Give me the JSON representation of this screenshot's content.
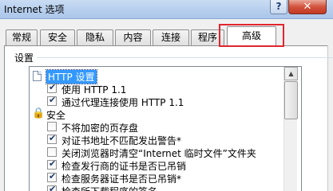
{
  "window": {
    "title": "Internet 选项",
    "help_label": "?",
    "close_label": "✕"
  },
  "tabs": [
    {
      "label": "常规"
    },
    {
      "label": "安全"
    },
    {
      "label": "隐私"
    },
    {
      "label": "内容"
    },
    {
      "label": "连接"
    },
    {
      "label": "程序"
    },
    {
      "label": "高级",
      "active": true
    }
  ],
  "settings": {
    "group_label": "设置",
    "items": [
      {
        "type": "category",
        "icon": "page-icon",
        "label": "HTTP 设置",
        "selected": true
      },
      {
        "type": "checkbox",
        "checked": true,
        "label": "使用 HTTP 1.1"
      },
      {
        "type": "checkbox",
        "checked": true,
        "label": "通过代理连接使用 HTTP 1.1"
      },
      {
        "type": "category",
        "icon": "lock-icon",
        "label": "安全"
      },
      {
        "type": "checkbox",
        "checked": false,
        "label": "不将加密的页存盘"
      },
      {
        "type": "checkbox",
        "checked": true,
        "label": "对证书地址不匹配发出警告*"
      },
      {
        "type": "checkbox",
        "checked": false,
        "label": "关闭浏览器时清空“Internet 临时文件”文件夹"
      },
      {
        "type": "checkbox",
        "checked": true,
        "label": "检查发行商的证书是否已吊销"
      },
      {
        "type": "checkbox",
        "checked": true,
        "label": "检查服务器证书是否已吊销*"
      },
      {
        "type": "checkbox",
        "checked": true,
        "label": "检查所下载程序的签名"
      }
    ]
  },
  "colors": {
    "highlight_border": "#e0262f",
    "selection": "#3399ff"
  }
}
